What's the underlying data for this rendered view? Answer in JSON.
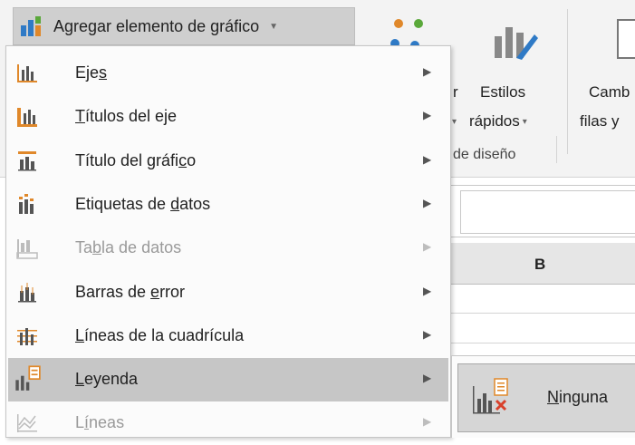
{
  "toolbar": {
    "add_element_label": "Agregar elemento de gráfico",
    "quick_layout_label": "r",
    "quick_layout_sub": "r",
    "styles_label": "Estilos",
    "styles_sub": "rápidos",
    "switch_label": "Camb",
    "switch_sub": "filas y",
    "group_label": "de diseño"
  },
  "sheet": {
    "column_b": "B"
  },
  "menu": {
    "items": [
      {
        "pre": "Eje",
        "u": "s",
        "post": "",
        "icon": "axes-icon",
        "disabled": false
      },
      {
        "pre": "",
        "u": "T",
        "post": "ítulos del eje",
        "icon": "axis-titles-icon",
        "disabled": false
      },
      {
        "pre": "Título del gráfi",
        "u": "c",
        "post": "o",
        "icon": "chart-title-icon",
        "disabled": false
      },
      {
        "pre": "Etiquetas de ",
        "u": "d",
        "post": "atos",
        "icon": "data-labels-icon",
        "disabled": false
      },
      {
        "pre": "Ta",
        "u": "b",
        "post": "la de datos",
        "icon": "data-table-icon",
        "disabled": true
      },
      {
        "pre": "Barras de ",
        "u": "e",
        "post": "rror",
        "icon": "error-bars-icon",
        "disabled": false
      },
      {
        "pre": "",
        "u": "L",
        "post": "íneas de la cuadrícula",
        "icon": "gridlines-icon",
        "disabled": false
      },
      {
        "pre": "",
        "u": "L",
        "post": "eyenda",
        "icon": "legend-icon",
        "disabled": false
      },
      {
        "pre": "L",
        "u": "í",
        "post": "neas",
        "icon": "lines-icon",
        "disabled": true
      }
    ]
  },
  "submenu": {
    "none_u": "N",
    "none_post": "inguna"
  },
  "colors": {
    "accent_orange": "#e0882a",
    "accent_blue": "#2f7ac6",
    "accent_green": "#5aa83a",
    "selected_bg": "#c6c6c6",
    "disabled_text": "#9a9a9a"
  }
}
